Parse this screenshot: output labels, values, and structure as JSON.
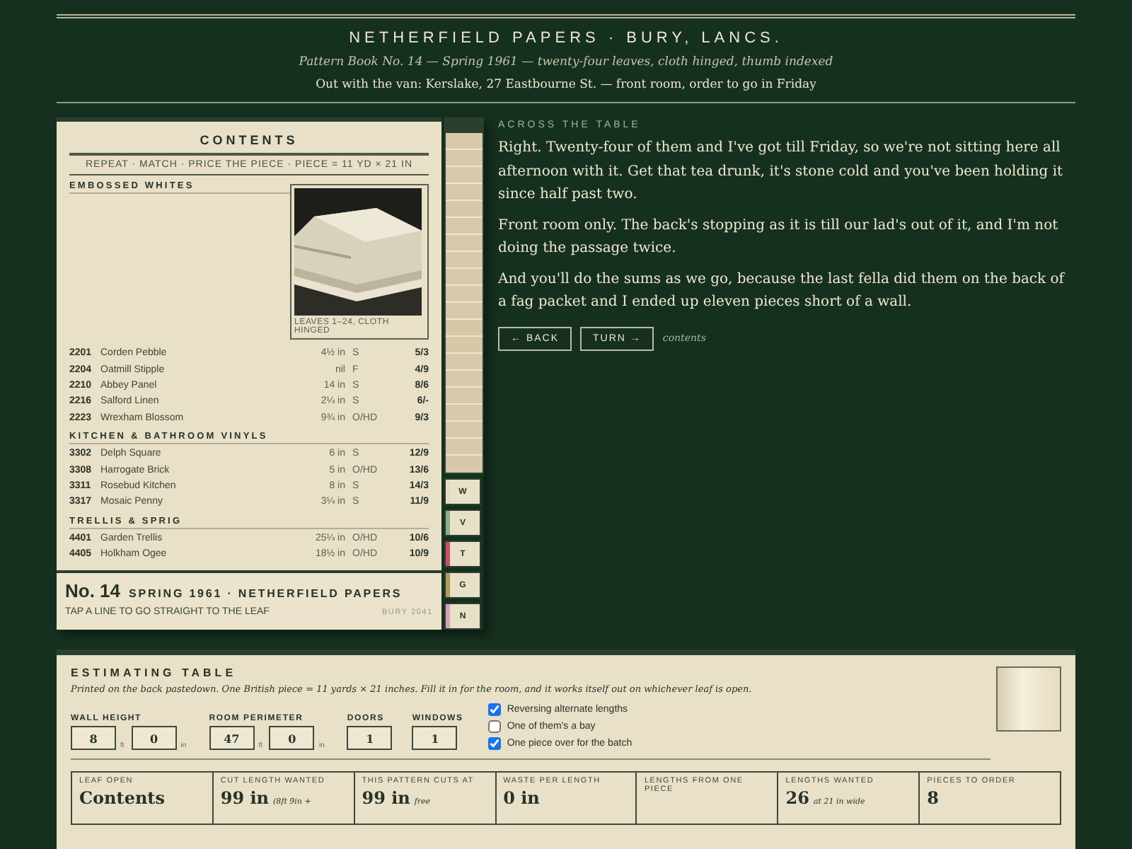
{
  "header": {
    "title": "NETHERFIELD PAPERS  ·  BURY, LANCS.",
    "subtitle": "Pattern Book No. 14  —  Spring 1961  —  twenty-four leaves, cloth hinged, thumb indexed",
    "van_line": "Out with the van: Kerslake, 27 Eastbourne St.  —  front room, order to go in Friday"
  },
  "book": {
    "heading": "CONTENTS",
    "key_line": "REPEAT · MATCH · PRICE THE PIECE · PIECE = 11 YD × 21 IN",
    "sections": [
      {
        "title": "EMBOSSED WHITES",
        "photo": {
          "kind": "picture",
          "caption": "LEAVES 1–24, CLOTH HINGED"
        },
        "items": [
          {
            "code": "2201",
            "name": "Corden Pebble",
            "repeat": "4½ in",
            "match": "S",
            "price": "5/3"
          },
          {
            "code": "2204",
            "name": "Oatmill Stipple",
            "repeat": "nil",
            "match": "F",
            "price": "4/9"
          },
          {
            "code": "2210",
            "name": "Abbey Panel",
            "repeat": "14 in",
            "match": "S",
            "price": "8/6"
          },
          {
            "code": "2216",
            "name": "Salford Linen",
            "repeat": "2¼ in",
            "match": "S",
            "price": "6/-"
          },
          {
            "code": "2223",
            "name": "Wrexham Blossom",
            "repeat": "9¾ in",
            "match": "O/HD",
            "price": "9/3"
          }
        ]
      },
      {
        "title": "KITCHEN & BATHROOM VINYLS",
        "items": [
          {
            "code": "3302",
            "name": "Delph Square",
            "repeat": "6 in",
            "match": "S",
            "price": "12/9"
          },
          {
            "code": "3308",
            "name": "Harrogate Brick",
            "repeat": "5 in",
            "match": "O/HD",
            "price": "13/6"
          },
          {
            "code": "3311",
            "name": "Rosebud Kitchen",
            "repeat": "8 in",
            "match": "S",
            "price": "14/3"
          },
          {
            "code": "3317",
            "name": "Mosaic Penny",
            "repeat": "3¼ in",
            "match": "S",
            "price": "11/9"
          }
        ]
      },
      {
        "title": "TRELLIS & SPRIG",
        "items": [
          {
            "code": "4401",
            "name": "Garden Trellis",
            "repeat": "25¼ in",
            "match": "O/HD",
            "price": "10/6"
          },
          {
            "code": "4405",
            "name": "Holkham Ogee",
            "repeat": "18½ in",
            "match": "O/HD",
            "price": "10/9"
          }
        ]
      }
    ],
    "footer": {
      "number": "No. 14",
      "edition": "SPRING 1961  ·  NETHERFIELD PAPERS",
      "hint": "TAP A LINE TO GO STRAIGHT TO THE LEAF",
      "stamp": "BURY 2041"
    },
    "thumb_tabs": [
      {
        "letter": "W",
        "color": "#e8dcc4"
      },
      {
        "letter": "V",
        "color": "#8fae8b"
      },
      {
        "letter": "T",
        "color": "#c8506a"
      },
      {
        "letter": "G",
        "color": "#b09a60"
      },
      {
        "letter": "N",
        "color": "#d9a0b8"
      }
    ]
  },
  "conversation": {
    "label": "ACROSS THE TABLE",
    "paragraphs": [
      "Right. Twenty-four of them and I've got till Friday, so we're not sitting here all afternoon with it. Get that tea drunk, it's stone cold and you've been holding it since half past two.",
      "Front room only. The back's stopping as it is till our lad's out of it, and I'm not doing the passage twice.",
      "And you'll do the sums as we go, because the last fella did them on the back of a fag packet and I ended up eleven pieces short of a wall."
    ],
    "back_button": "← BACK",
    "turn_button": "TURN →",
    "page_note": "contents"
  },
  "estimating": {
    "title": "ESTIMATING TABLE",
    "note": "Printed on the back pastedown. One British piece = 11 yards × 21 inches. Fill it in for the room, and it works itself out on whichever leaf is open.",
    "fields": [
      {
        "label": "WALL HEIGHT",
        "parts": [
          {
            "value": "8",
            "unit": "ft"
          },
          {
            "value": "0",
            "unit": "in"
          }
        ]
      },
      {
        "label": "ROOM PERIMETER",
        "parts": [
          {
            "value": "47",
            "unit": "ft"
          },
          {
            "value": "0",
            "unit": "in"
          }
        ]
      },
      {
        "label": "DOORS",
        "parts": [
          {
            "value": "1"
          }
        ]
      },
      {
        "label": "WINDOWS",
        "parts": [
          {
            "value": "1"
          }
        ]
      }
    ],
    "options": [
      {
        "label": "Reversing alternate lengths",
        "checked": true
      },
      {
        "label": "One of them's a bay",
        "checked": false
      },
      {
        "label": "One piece over for the batch",
        "checked": true
      }
    ],
    "results": [
      {
        "label": "LEAF OPEN",
        "value": "Contents"
      },
      {
        "label": "CUT LENGTH WANTED",
        "value": "99 in",
        "note": "(8ft 9in +"
      },
      {
        "label": "THIS PATTERN CUTS AT",
        "value": "99 in",
        "note": "free"
      },
      {
        "label": "WASTE PER LENGTH",
        "value": "0 in"
      },
      {
        "label": "LENGTHS FROM ONE PIECE"
      },
      {
        "label": "LENGTHS WANTED",
        "value": "26",
        "note": "at 21 in wide"
      },
      {
        "label": "PIECES TO ORDER",
        "value": "8"
      }
    ]
  }
}
